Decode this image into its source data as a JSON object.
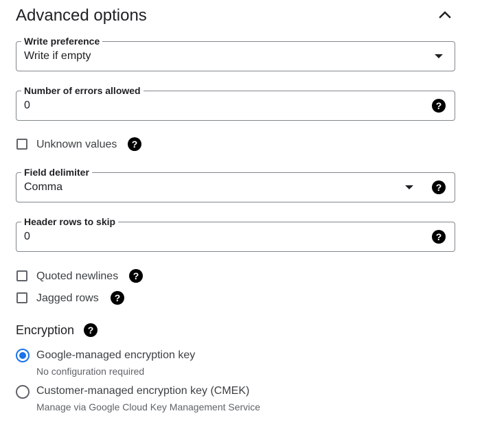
{
  "header": {
    "title": "Advanced options",
    "collapse_icon": "chevron-up-icon"
  },
  "write_preference": {
    "label": "Write preference",
    "value": "Write if empty"
  },
  "errors_allowed": {
    "label": "Number of errors allowed",
    "value": "0"
  },
  "unknown_values": {
    "label": "Unknown values",
    "checked": false
  },
  "field_delimiter": {
    "label": "Field delimiter",
    "value": "Comma"
  },
  "header_rows": {
    "label": "Header rows to skip",
    "value": "0"
  },
  "quoted_newlines": {
    "label": "Quoted newlines",
    "checked": false
  },
  "jagged_rows": {
    "label": "Jagged rows",
    "checked": false
  },
  "encryption": {
    "title": "Encryption",
    "options": [
      {
        "label": "Google-managed encryption key",
        "sublabel": "No configuration required",
        "selected": true
      },
      {
        "label": "Customer-managed encryption key (CMEK)",
        "sublabel": "Manage via Google Cloud Key Management Service",
        "selected": false
      }
    ]
  },
  "colors": {
    "accent": "#1a73e8",
    "border": "#80868b",
    "text": "#202124",
    "muted": "#5f6368"
  }
}
